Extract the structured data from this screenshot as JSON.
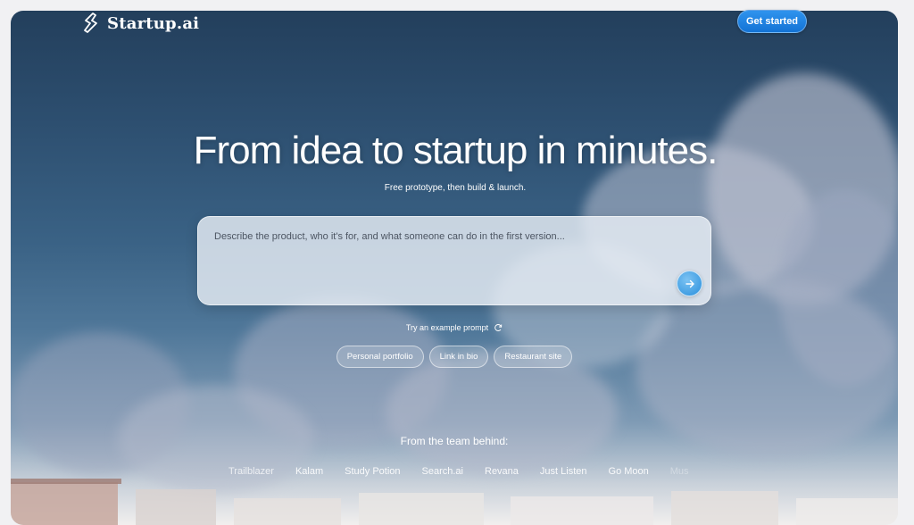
{
  "nav": {
    "brand": "Startup.ai",
    "cta_label": "Get started"
  },
  "hero": {
    "headline": "From idea to startup in minutes.",
    "subline": "Free prototype, then build & launch."
  },
  "prompt": {
    "placeholder": "Describe the product, who it's for, and what someone can do in the first version..."
  },
  "examples": {
    "label": "Try an example prompt",
    "chips": [
      "Personal portfolio",
      "Link in bio",
      "Restaurant site"
    ]
  },
  "team": {
    "heading": "From the team behind:",
    "products": [
      "Trailblazer",
      "Kalam",
      "Study Potion",
      "Search.ai",
      "Revana",
      "Just Listen",
      "Go Moon",
      "Mus"
    ]
  },
  "colors": {
    "accent": "#1a7fe0",
    "sky_top": "#233f5c"
  },
  "icons": {
    "logo": "startup-logo-icon",
    "send": "arrow-right-icon",
    "refresh": "refresh-icon"
  }
}
